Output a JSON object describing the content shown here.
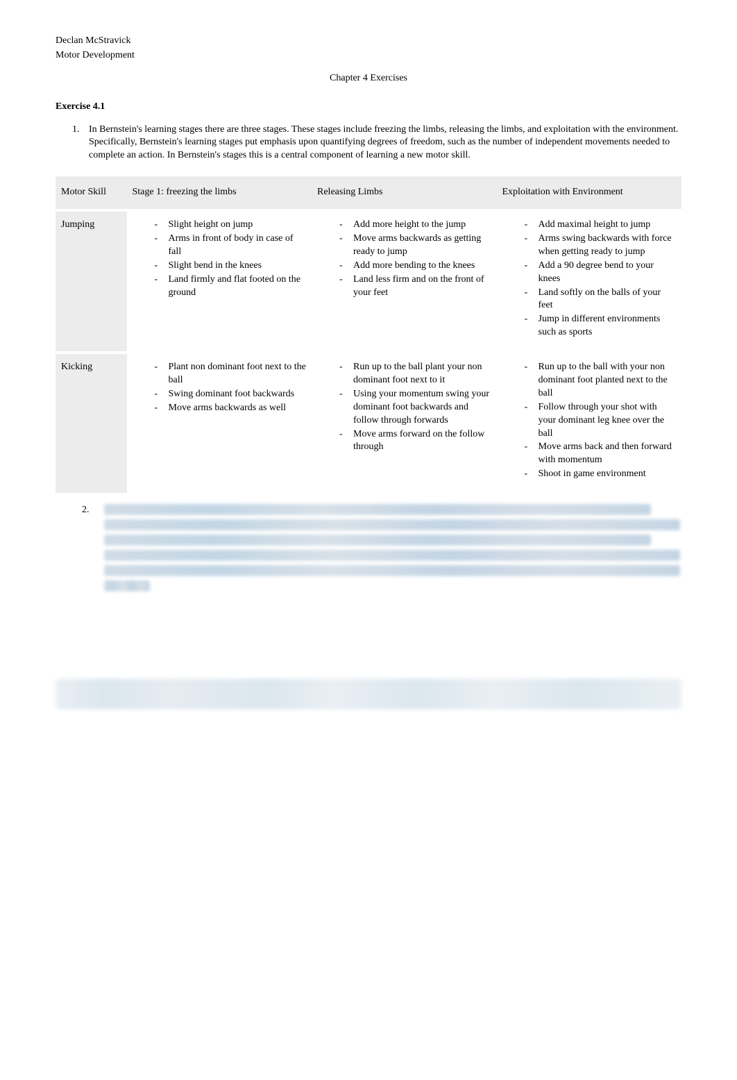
{
  "header": {
    "author": "Declan McStravick",
    "course": "Motor Development",
    "chapter_title": "Chapter 4 Exercises"
  },
  "exercise": {
    "title": "Exercise 4.1",
    "item1_text": "In Bernstein's learning stages there are three stages. These stages  include freezing the limbs, releasing the limbs, and exploitation with the environment. Specifically, Bernstein's learning stages put emphasis upon quantifying degrees of freedom, such as the number of independent movements needed to complete an action. In Bernstein's stages this is a central component of learning a new motor skill.",
    "item2_number": "2."
  },
  "table": {
    "headers": {
      "col1": "Motor Skill",
      "col2": "Stage 1: freezing the limbs",
      "col3": "Releasing Limbs",
      "col4": "Exploitation with Environment"
    },
    "rows": [
      {
        "skill": "Jumping",
        "stage1": [
          "Slight height on jump",
          "Arms in front of body in case of fall",
          "Slight bend in the knees",
          "Land firmly and flat footed on the ground"
        ],
        "releasing": [
          "Add more height to the jump",
          "Move arms backwards as getting ready to jump",
          "Add more bending to the knees",
          "Land less firm and on the front of your feet"
        ],
        "exploitation": [
          "Add maximal height to jump",
          "Arms swing backwards with force when getting ready to jump",
          "Add a 90 degree bend to your knees",
          "Land softly on the balls of your feet",
          "Jump in different environments such as sports"
        ]
      },
      {
        "skill": "Kicking",
        "stage1": [
          "Plant non dominant foot next to the ball",
          "Swing dominant foot backwards",
          "Move arms backwards as well"
        ],
        "releasing": [
          "Run up to the ball plant your non dominant foot next to it",
          "Using your momentum swing your dominant foot backwards and follow through forwards",
          "Move arms forward on the follow through"
        ],
        "exploitation": [
          "Run up to the ball with your non dominant foot planted next to the ball",
          "Follow through your shot with your dominant leg knee over the ball",
          "Move arms back and then forward with momentum",
          "Shoot in game environment"
        ]
      }
    ]
  }
}
